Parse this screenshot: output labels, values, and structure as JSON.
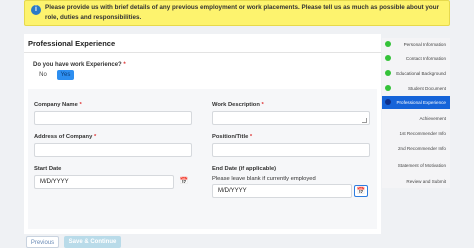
{
  "alert": {
    "icon": "info-icon",
    "text": "Please provide us with brief details of any previous employment or work placements. Please tell us as much as possible about your role, duties and responsibilities."
  },
  "main": {
    "title": "Professional Experience",
    "question": "Do you have work Experience?",
    "required_mark": "*",
    "toggle": {
      "no": "No",
      "yes": "Yes",
      "selected": "Yes"
    }
  },
  "form": {
    "company_name_label": "Company Name",
    "company_name_value": "",
    "work_description_label": "Work Description",
    "work_description_value": "",
    "company_address_label": "Address of Company",
    "company_address_value": "",
    "position_label": "Position/Title",
    "position_value": "",
    "start_date_label": "Start Date",
    "start_date_placeholder": "M/D/YYYY",
    "end_date_label": "End Date (if applicable)",
    "end_date_hint": "Please leave blank if currently employed",
    "end_date_placeholder": "M/D/YYYY",
    "calendar_icon": "calendar-icon"
  },
  "sidebar": {
    "steps": [
      {
        "label": "Personal Information",
        "status": "complete"
      },
      {
        "label": "Contact Information",
        "status": "complete"
      },
      {
        "label": "Educational Background",
        "status": "complete"
      },
      {
        "label": "Student Document",
        "status": "complete"
      },
      {
        "label": "Professional Experience",
        "status": "active"
      },
      {
        "label": "Achievement",
        "status": "pending"
      },
      {
        "label": "1st Recommender Info",
        "status": "pending"
      },
      {
        "label": "2nd Recommender Info",
        "status": "pending"
      },
      {
        "label": "Statement of Motivation",
        "status": "pending"
      },
      {
        "label": "Review and Submit",
        "status": "pending"
      }
    ],
    "colors": {
      "complete": "#35c33a",
      "active": "#1664d9"
    }
  },
  "footer": {
    "previous": "Previous",
    "save_continue": "Save & Continue"
  }
}
